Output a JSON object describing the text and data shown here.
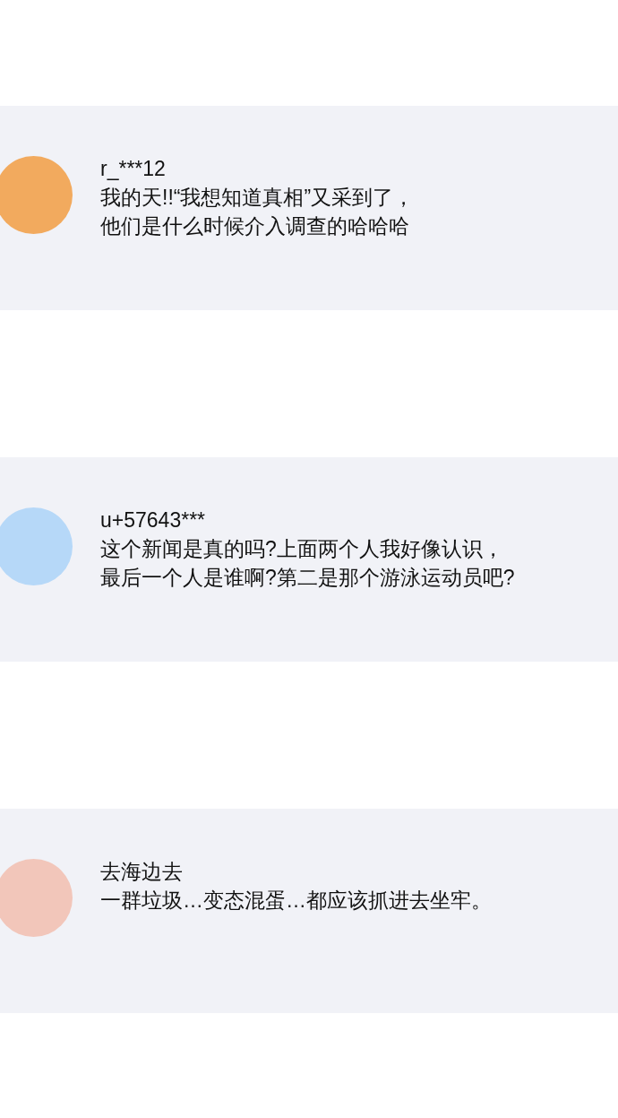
{
  "comments": [
    {
      "username": "r_***12",
      "color": "#f2aa5e",
      "lines": [
        "我的天!!“我想知道真相”又采到了，",
        "他们是什么时候介入调查的哈哈哈"
      ]
    },
    {
      "username": "u+57643***",
      "color": "#b6d8f8",
      "lines": [
        "这个新闻是真的吗?上面两个人我好像认识，",
        "最后一个人是谁啊?第二是那个游泳运动员吧?"
      ]
    },
    {
      "username": "去海边去",
      "color": "#f2c6ba",
      "lines": [
        "一群垃圾…变态混蛋…都应该抓进去坐牢。"
      ]
    }
  ]
}
